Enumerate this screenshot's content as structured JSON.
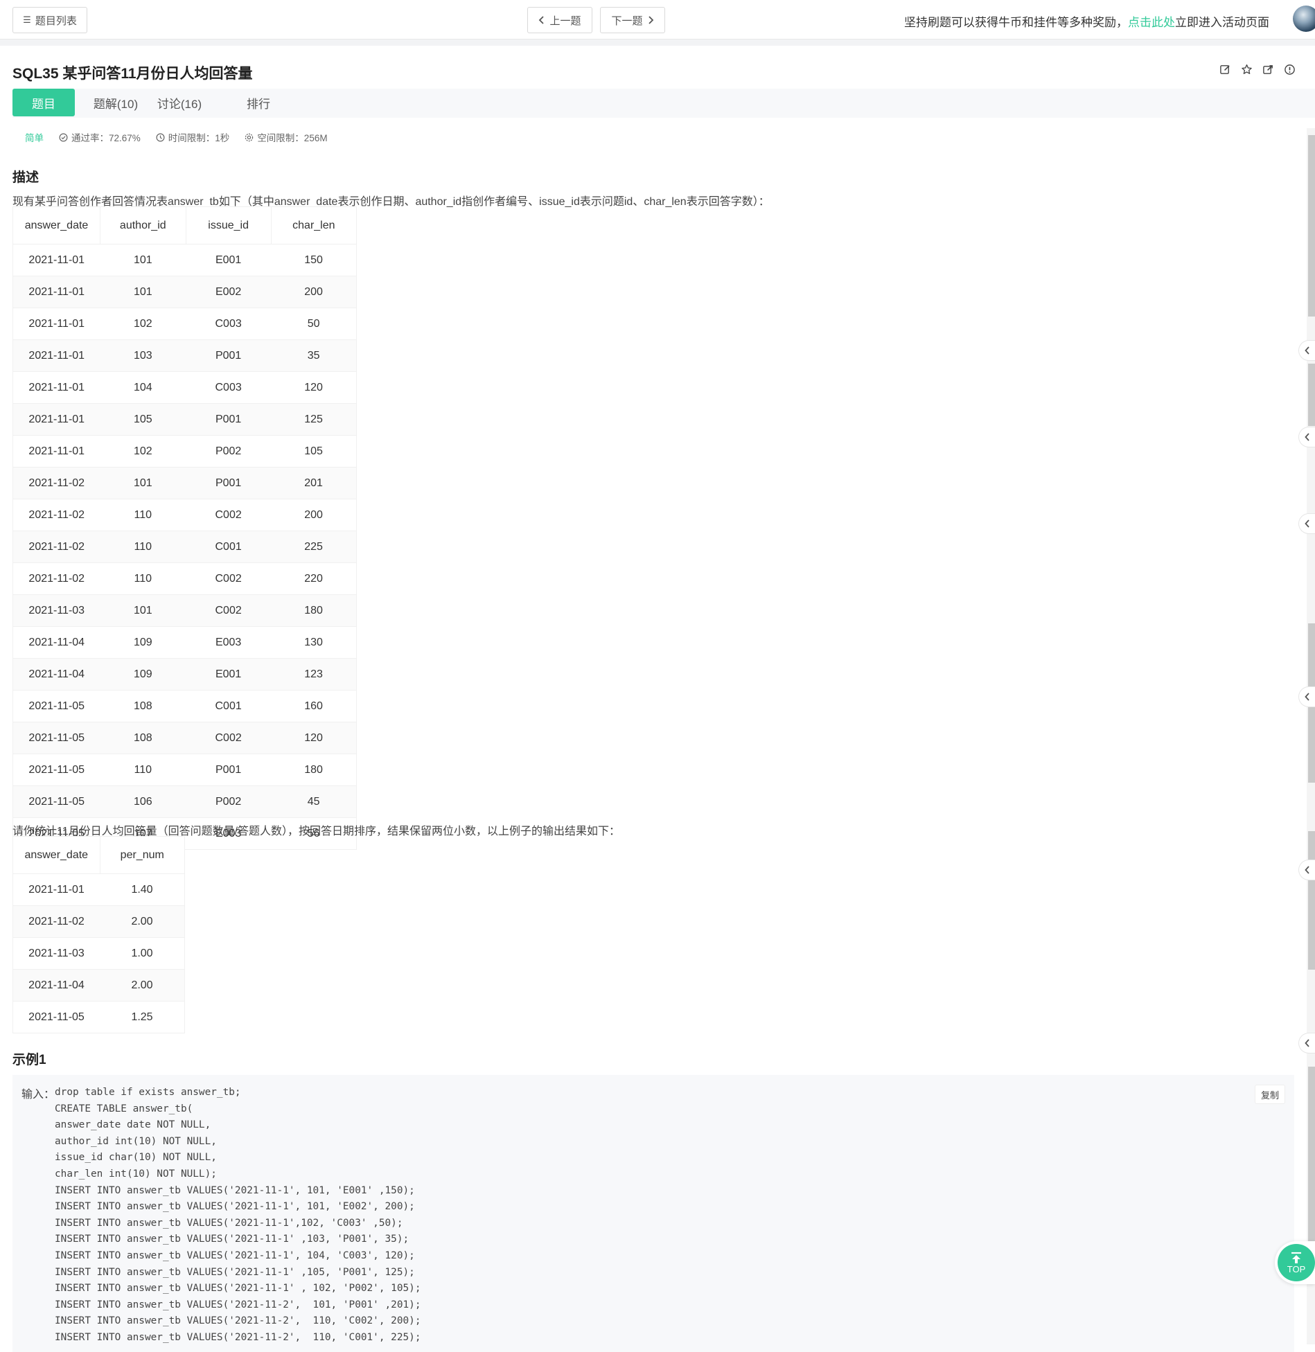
{
  "header": {
    "list_button": "题目列表",
    "prev_button": "上一题",
    "next_button": "下一题",
    "promo_before": "坚持刷题可以获得牛币和挂件等多种奖励，",
    "promo_link": "点击此处",
    "promo_after": "立即进入活动页面"
  },
  "problem": {
    "title": "SQL35  某乎问答11月份日人均回答量",
    "tabs": [
      {
        "label": "题目",
        "active": true
      },
      {
        "label": "题解(10)",
        "active": false
      },
      {
        "label": "讨论(16)",
        "active": false
      },
      {
        "label": "排行",
        "active": false
      }
    ],
    "difficulty": "简单",
    "pass_rate": "通过率：72.67%",
    "time_limit": "时间限制：1秒",
    "space_limit": "空间限制：256M"
  },
  "description": {
    "heading": "描述",
    "intro": "现有某乎问答创作者回答情况表answer_tb如下（其中answer_date表示创作日期、author_id指创作者编号、issue_id表示问题id、char_len表示回答字数）：",
    "table": {
      "headers": [
        "answer_date",
        "author_id",
        "issue_id",
        "char_len"
      ],
      "rows": [
        [
          "2021-11-01",
          "101",
          "E001",
          "150"
        ],
        [
          "2021-11-01",
          "101",
          "E002",
          "200"
        ],
        [
          "2021-11-01",
          "102",
          "C003",
          "50"
        ],
        [
          "2021-11-01",
          "103",
          "P001",
          "35"
        ],
        [
          "2021-11-01",
          "104",
          "C003",
          "120"
        ],
        [
          "2021-11-01",
          "105",
          "P001",
          "125"
        ],
        [
          "2021-11-01",
          "102",
          "P002",
          "105"
        ],
        [
          "2021-11-02",
          "101",
          "P001",
          "201"
        ],
        [
          "2021-11-02",
          "110",
          "C002",
          "200"
        ],
        [
          "2021-11-02",
          "110",
          "C001",
          "225"
        ],
        [
          "2021-11-02",
          "110",
          "C002",
          "220"
        ],
        [
          "2021-11-03",
          "101",
          "C002",
          "180"
        ],
        [
          "2021-11-04",
          "109",
          "E003",
          "130"
        ],
        [
          "2021-11-04",
          "109",
          "E001",
          "123"
        ],
        [
          "2021-11-05",
          "108",
          "C001",
          "160"
        ],
        [
          "2021-11-05",
          "108",
          "C002",
          "120"
        ],
        [
          "2021-11-05",
          "110",
          "P001",
          "180"
        ],
        [
          "2021-11-05",
          "106",
          "P002",
          "45"
        ],
        [
          "2021-11-05",
          "107",
          "E003",
          "56"
        ]
      ]
    },
    "question": "请你统计11月份日人均回答量（回答问题数量/答题人数），按回答日期排序，结果保留两位小数，以上例子的输出结果如下：",
    "result_table": {
      "headers": [
        "answer_date",
        "per_num"
      ],
      "rows": [
        [
          "2021-11-01",
          "1.40"
        ],
        [
          "2021-11-02",
          "2.00"
        ],
        [
          "2021-11-03",
          "1.00"
        ],
        [
          "2021-11-04",
          "2.00"
        ],
        [
          "2021-11-05",
          "1.25"
        ]
      ]
    }
  },
  "example": {
    "heading": "示例1",
    "input_label": "输入：",
    "copy_button": "复制",
    "code": "drop table if exists answer_tb;\nCREATE TABLE answer_tb(\nanswer_date date NOT NULL,\nauthor_id int(10) NOT NULL,\nissue_id char(10) NOT NULL,\nchar_len int(10) NOT NULL);\nINSERT INTO answer_tb VALUES('2021-11-1', 101, 'E001' ,150);\nINSERT INTO answer_tb VALUES('2021-11-1', 101, 'E002', 200);\nINSERT INTO answer_tb VALUES('2021-11-1',102, 'C003' ,50);\nINSERT INTO answer_tb VALUES('2021-11-1' ,103, 'P001', 35);\nINSERT INTO answer_tb VALUES('2021-11-1', 104, 'C003', 120);\nINSERT INTO answer_tb VALUES('2021-11-1' ,105, 'P001', 125);\nINSERT INTO answer_tb VALUES('2021-11-1' , 102, 'P002', 105);\nINSERT INTO answer_tb VALUES('2021-11-2',  101, 'P001' ,201);\nINSERT INTO answer_tb VALUES('2021-11-2',  110, 'C002', 200);\nINSERT INTO answer_tb VALUES('2021-11-2',  110, 'C001', 225);"
  },
  "top_button": "TOP",
  "colors": {
    "accent": "#32ca99",
    "code_bg": "#f7f8fa"
  }
}
